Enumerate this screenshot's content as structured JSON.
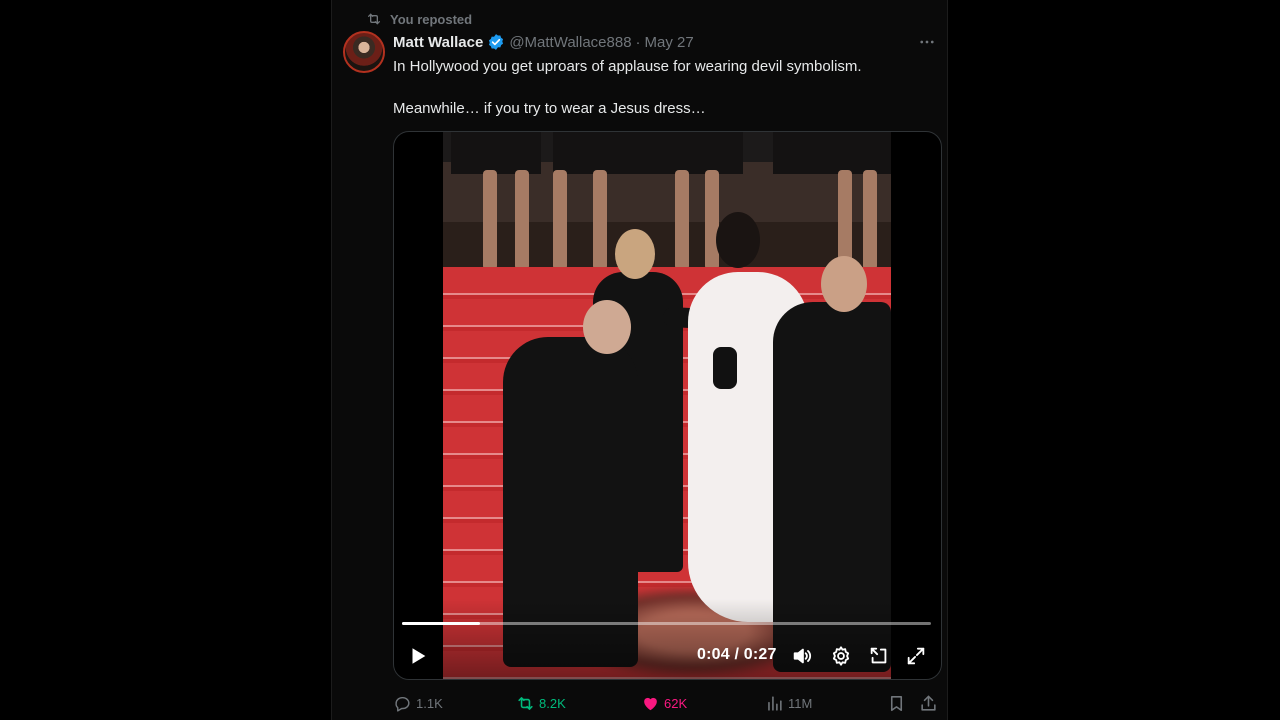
{
  "repost": {
    "label": "You reposted"
  },
  "author": {
    "name": "Matt Wallace",
    "handle": "@MattWallace888",
    "separator": "·",
    "date": "May 27"
  },
  "tweet": {
    "line1": "In Hollywood you get uproars of applause for wearing devil symbolism.",
    "line2": "Meanwhile… if you try to wear a Jesus dress…"
  },
  "video": {
    "current_time": "0:04",
    "duration": "0:27",
    "time_separator": " / ",
    "progress_fraction": 0.148
  },
  "actions": {
    "replies": "1.1K",
    "retweets": "8.2K",
    "likes": "62K",
    "views": "11M"
  },
  "colors": {
    "verified": "#1d9bf0",
    "retweet": "#00ba7c",
    "like": "#f91880",
    "carpet": "#c62b2e"
  }
}
